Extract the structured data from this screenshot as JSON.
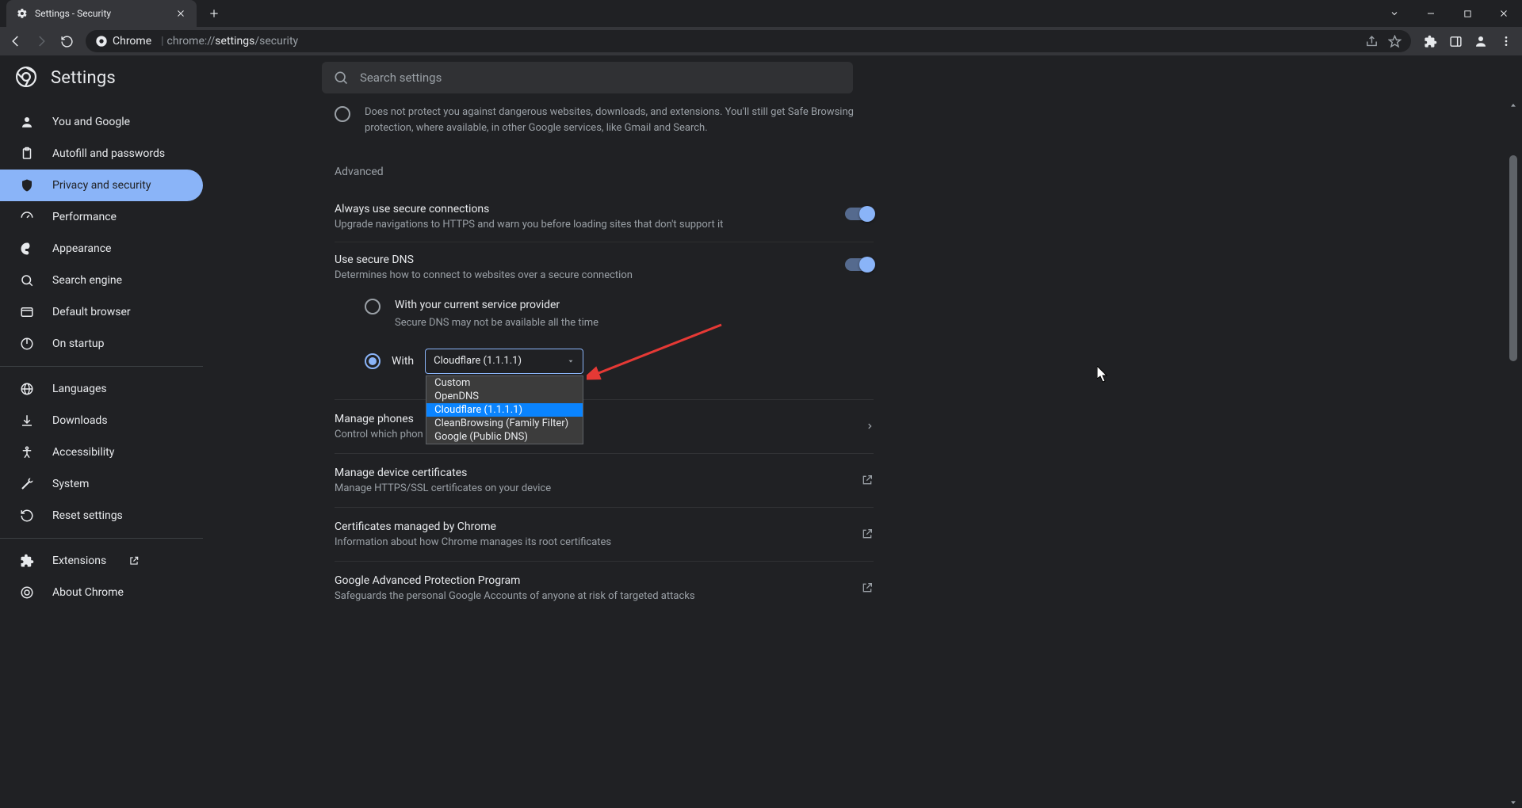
{
  "tab": {
    "title": "Settings - Security"
  },
  "omnibox": {
    "site": "Chrome",
    "url_prefix": "chrome://",
    "url_mid": "settings",
    "url_suffix": "/security"
  },
  "page": {
    "title": "Settings",
    "search_placeholder": "Search settings"
  },
  "sidebar": {
    "items": [
      {
        "label": "You and Google"
      },
      {
        "label": "Autofill and passwords"
      },
      {
        "label": "Privacy and security"
      },
      {
        "label": "Performance"
      },
      {
        "label": "Appearance"
      },
      {
        "label": "Search engine"
      },
      {
        "label": "Default browser"
      },
      {
        "label": "On startup"
      }
    ],
    "items2": [
      {
        "label": "Languages"
      },
      {
        "label": "Downloads"
      },
      {
        "label": "Accessibility"
      },
      {
        "label": "System"
      },
      {
        "label": "Reset settings"
      }
    ],
    "items3": [
      {
        "label": "Extensions"
      },
      {
        "label": "About Chrome"
      }
    ]
  },
  "content": {
    "safe_browsing_no_protection": "Does not protect you against dangerous websites, downloads, and extensions. You'll still get Safe Browsing protection, where available, in other Google services, like Gmail and Search.",
    "advanced_label": "Advanced",
    "secure_conn": {
      "title": "Always use secure connections",
      "sub": "Upgrade navigations to HTTPS and warn you before loading sites that don't support it"
    },
    "secure_dns": {
      "title": "Use secure DNS",
      "sub": "Determines how to connect to websites over a secure connection",
      "opt_provider_title": "With your current service provider",
      "opt_provider_sub": "Secure DNS may not be available all the time",
      "with_label": "With",
      "selected": "Cloudflare (1.1.1.1)",
      "options": [
        "Custom",
        "OpenDNS",
        "Cloudflare (1.1.1.1)",
        "CleanBrowsing (Family Filter)",
        "Google (Public DNS)"
      ]
    },
    "manage_phones": {
      "title": "Manage phones",
      "sub": "Control which phon"
    },
    "manage_certs": {
      "title": "Manage device certificates",
      "sub": "Manage HTTPS/SSL certificates on your device"
    },
    "chrome_certs": {
      "title": "Certificates managed by Chrome",
      "sub": "Information about how Chrome manages its root certificates"
    },
    "gapp": {
      "title": "Google Advanced Protection Program",
      "sub": "Safeguards the personal Google Accounts of anyone at risk of targeted attacks"
    }
  }
}
